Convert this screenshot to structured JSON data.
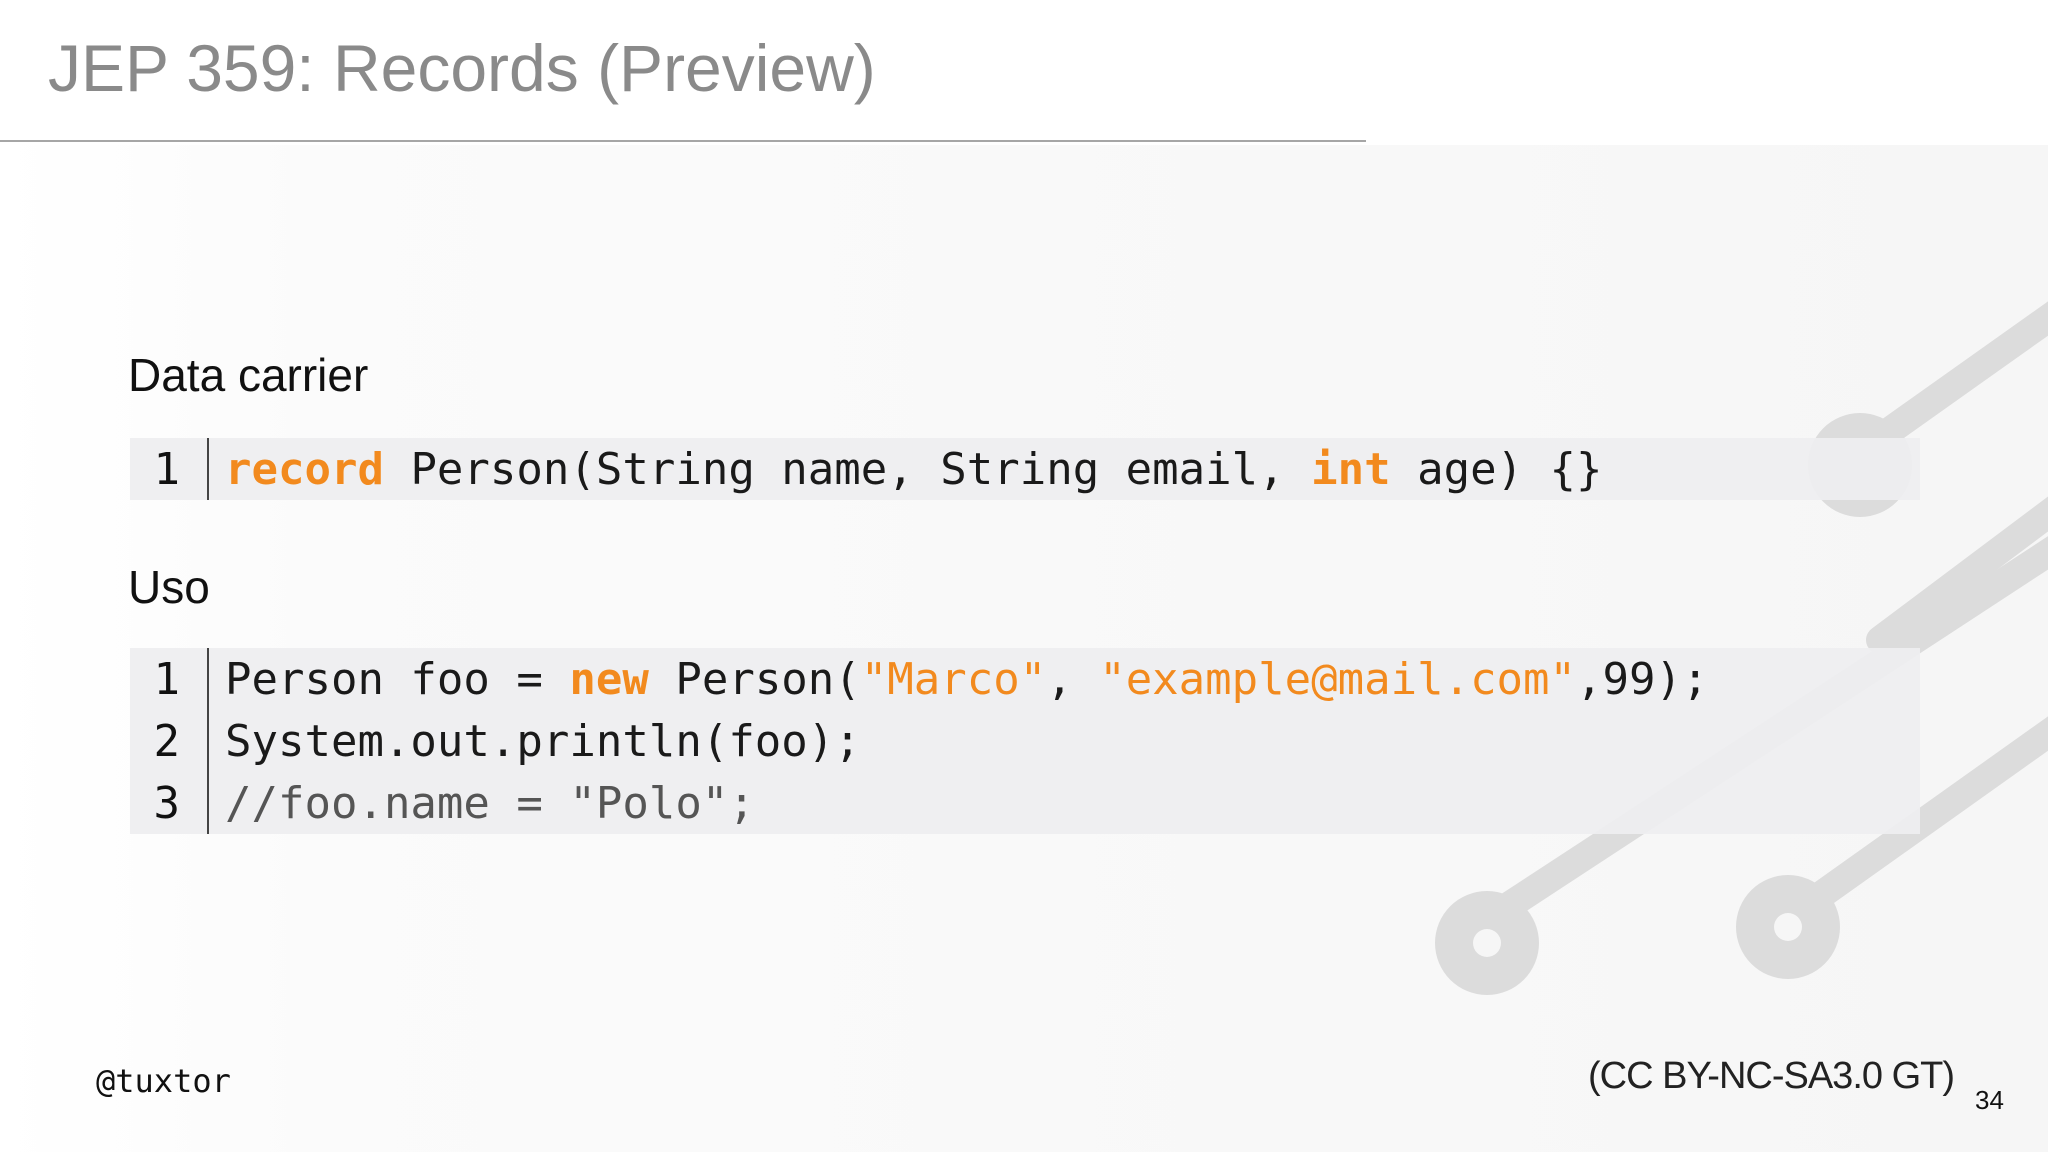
{
  "slide": {
    "title": "JEP 359: Records (Preview)",
    "page_number": "34",
    "handle": "@tuxtor",
    "license": "(CC BY-NC-SA3.0 GT)"
  },
  "section_data_carrier": {
    "label": "Data carrier",
    "lines": [
      {
        "number": "1",
        "tokens": [
          {
            "text": "record",
            "kind": "keyword"
          },
          {
            "text": " Person(String name, String email, ",
            "kind": "plain"
          },
          {
            "text": "int",
            "kind": "keyword"
          },
          {
            "text": " age) {}",
            "kind": "plain"
          }
        ]
      }
    ]
  },
  "section_uso": {
    "label": "Uso",
    "lines": [
      {
        "number": "1",
        "tokens": [
          {
            "text": "Person foo = ",
            "kind": "plain"
          },
          {
            "text": "new",
            "kind": "keyword"
          },
          {
            "text": " Person(",
            "kind": "plain"
          },
          {
            "text": "\"Marco\"",
            "kind": "string"
          },
          {
            "text": ", ",
            "kind": "plain"
          },
          {
            "text": "\"example@mail.com\"",
            "kind": "string"
          },
          {
            "text": ",99);",
            "kind": "plain"
          }
        ]
      },
      {
        "number": "2",
        "tokens": [
          {
            "text": "System.out.println(foo);",
            "kind": "plain"
          }
        ]
      },
      {
        "number": "3",
        "tokens": [
          {
            "text": "//foo.name = \"Polo\";",
            "kind": "comment"
          }
        ]
      }
    ]
  },
  "colors": {
    "title": "#8a8a8a",
    "keyword": "#f28a1e",
    "string": "#f28a1e",
    "comment": "#555555",
    "code_background": "#eeeef0",
    "circuit_decoration": "#dcdcdc"
  },
  "decorations": [
    "circuit-board-traces"
  ]
}
